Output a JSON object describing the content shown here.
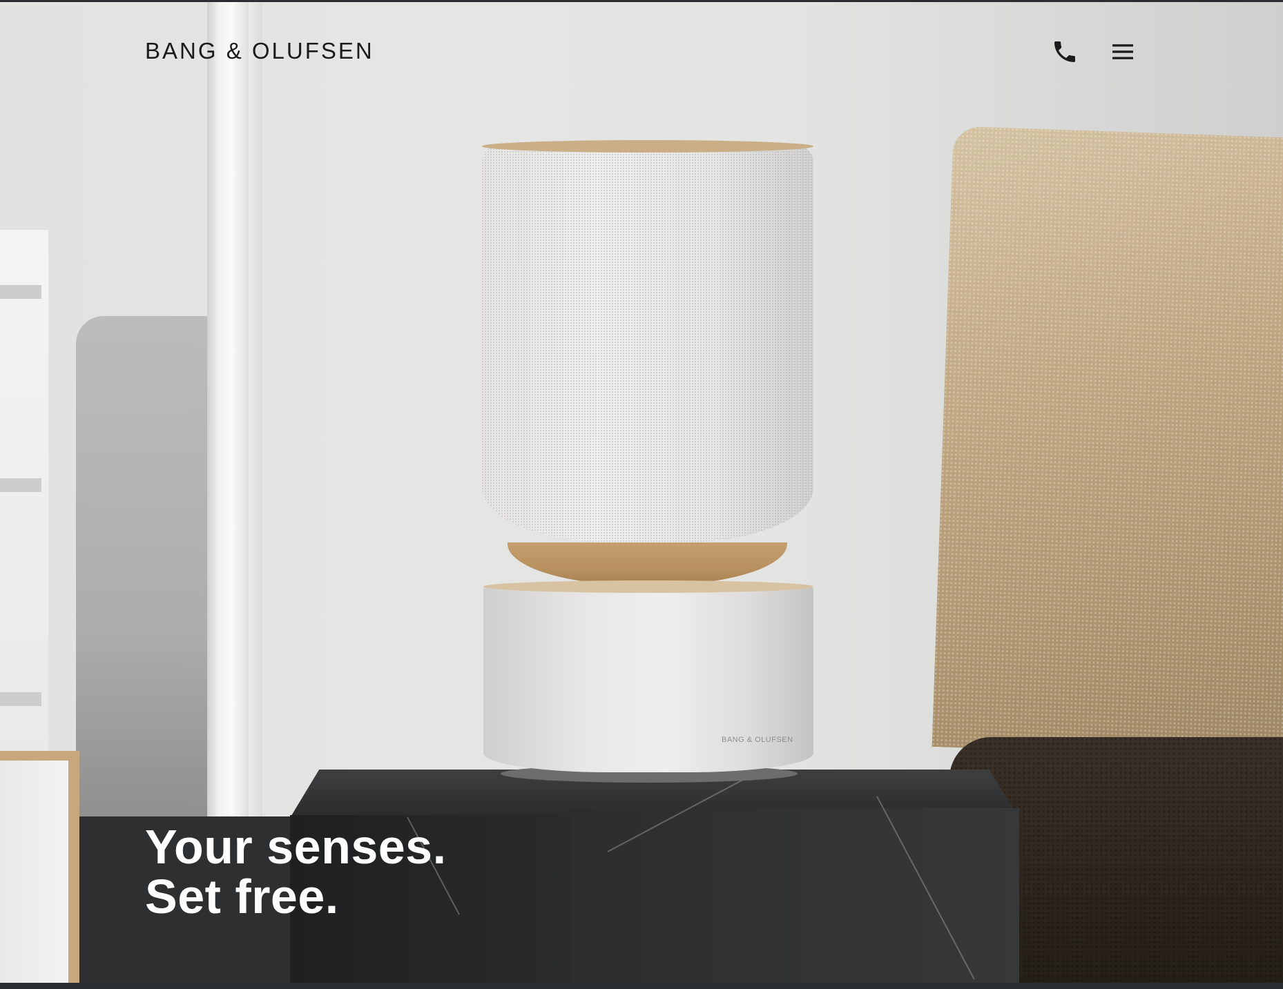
{
  "header": {
    "brand": "BANG & OLUFSEN",
    "phone_icon": "phone-icon",
    "menu_icon": "hamburger-menu-icon"
  },
  "hero": {
    "headline_line1": "Your senses.",
    "headline_line2": "Set free.",
    "product_logo": "BANG & OLUFSEN"
  },
  "colors": {
    "brand_text": "#1b1b1b",
    "headline_text": "#ffffff",
    "accent_wood": "#c69f6f"
  }
}
